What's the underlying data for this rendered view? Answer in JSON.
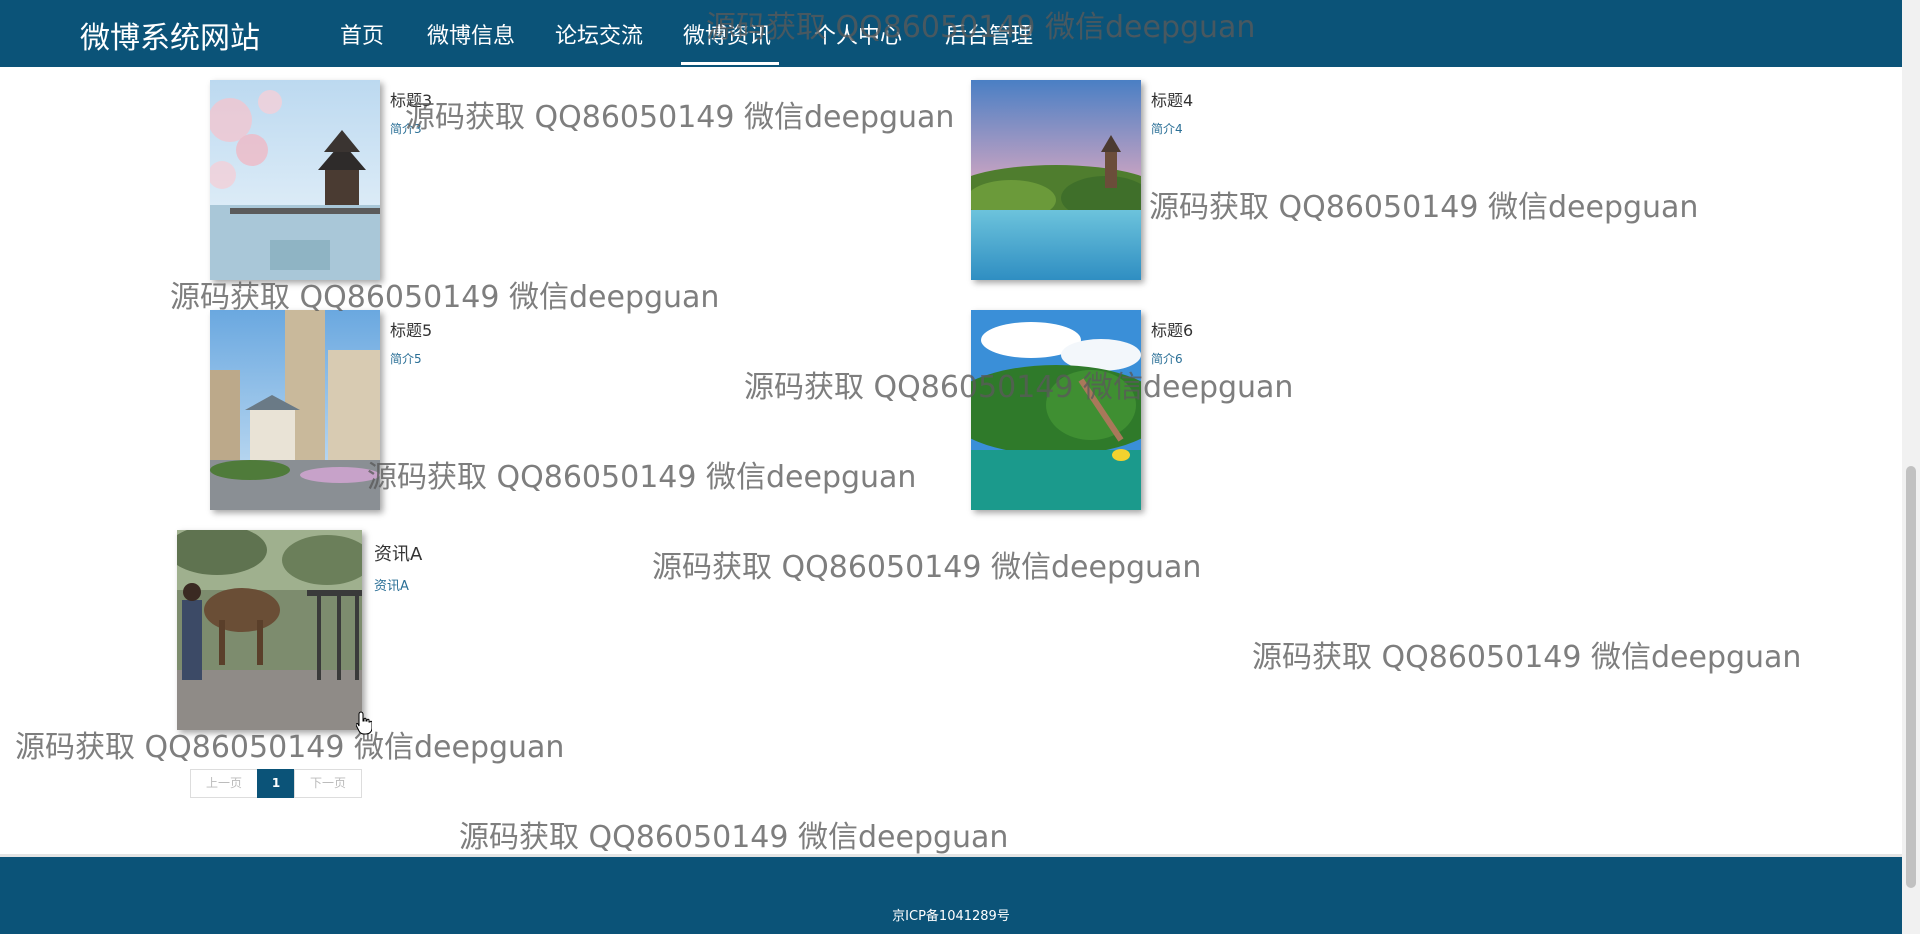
{
  "site": {
    "brand": "微博系统网站"
  },
  "nav": [
    {
      "label": "首页"
    },
    {
      "label": "微博信息"
    },
    {
      "label": "论坛交流"
    },
    {
      "label": "微博资讯",
      "active": true
    },
    {
      "label": "个人中心"
    },
    {
      "label": "后台管理"
    }
  ],
  "cards": [
    {
      "title": "标题3",
      "intro": "简介3",
      "image": "lake-pavilion-cherry-blossom"
    },
    {
      "title": "标题4",
      "intro": "简介4",
      "image": "lake-pagoda-hill"
    },
    {
      "title": "标题5",
      "intro": "简介5",
      "image": "residential-towers"
    },
    {
      "title": "标题6",
      "intro": "简介6",
      "image": "green-hill-lake-duck"
    },
    {
      "title": "资讯A",
      "intro": "资讯A",
      "image": "camel-zoo"
    }
  ],
  "pagination": {
    "prev": "上一页",
    "current": "1",
    "next": "下一页"
  },
  "footer": {
    "icp": "京ICP备1041289号"
  },
  "watermark": {
    "text": "源码获取 QQ86050149 微信deepguan"
  },
  "colors": {
    "primary": "#0b5378",
    "link": "#2a6f96"
  },
  "icons": {
    "cursor": "hand-pointer-icon"
  }
}
